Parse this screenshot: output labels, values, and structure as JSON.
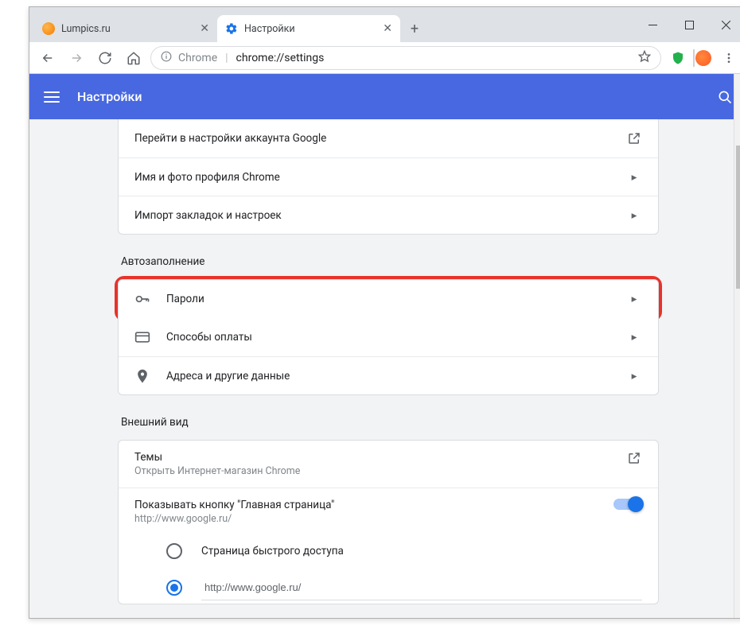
{
  "tabs": {
    "lumpics": "Lumpics.ru",
    "settings": "Настройки"
  },
  "addr": {
    "scheme": "Chrome",
    "path": "chrome://settings"
  },
  "app": {
    "title": "Настройки"
  },
  "account_card": {
    "google_settings": "Перейти в настройки аккаунта Google",
    "profile_name": "Имя и фото профиля Chrome",
    "import": "Импорт закладок и настроек"
  },
  "sections": {
    "autofill": "Автозаполнение",
    "appearance": "Внешний вид"
  },
  "autofill": {
    "passwords": "Пароли",
    "payment": "Способы оплаты",
    "addresses": "Адреса и другие данные"
  },
  "appearance": {
    "themes": "Темы",
    "themes_sub": "Открыть Интернет-магазин Chrome",
    "home_button": "Показывать кнопку \"Главная страница\"",
    "home_url": "http://www.google.ru/",
    "radio_quick": "Страница быстрого доступа",
    "radio_url_value": "http://www.google.ru/"
  }
}
